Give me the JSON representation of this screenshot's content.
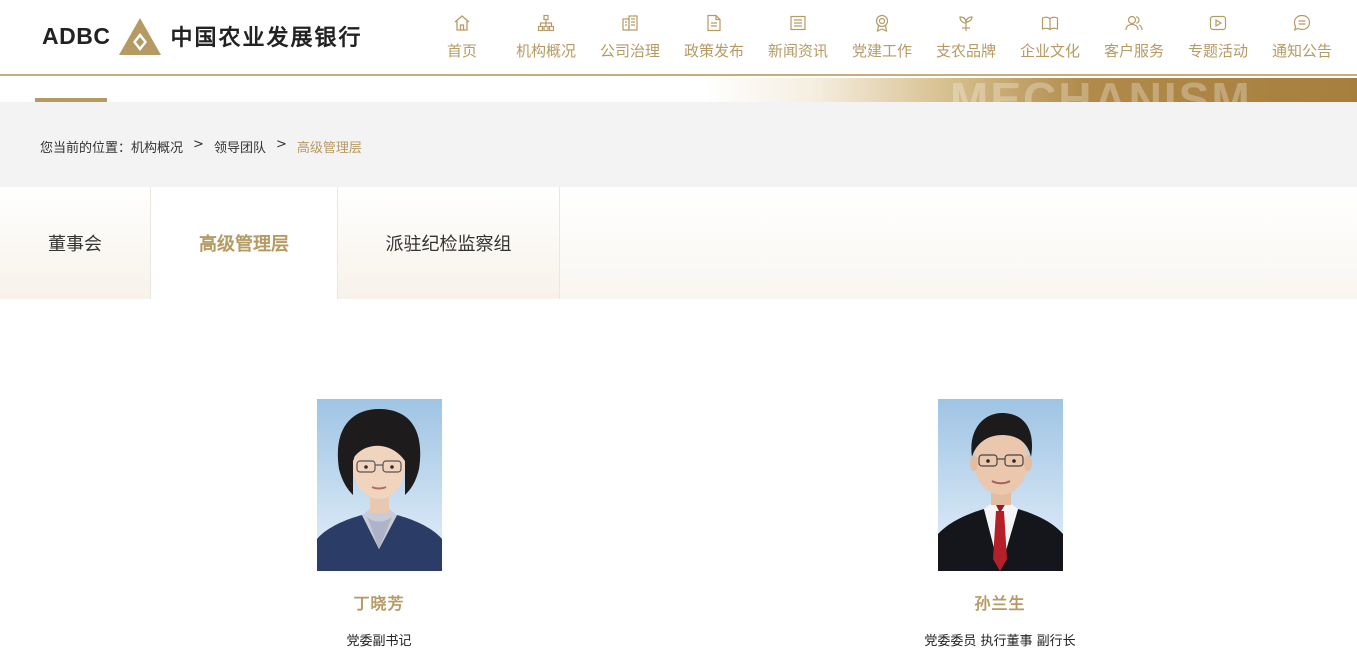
{
  "header": {
    "logo_en": "ADBC",
    "logo_cn": "中国农业发展银行",
    "brand_color": "#b69a64"
  },
  "nav": [
    {
      "label": "首页",
      "icon": "home-icon"
    },
    {
      "label": "机构概况",
      "icon": "org-chart-icon"
    },
    {
      "label": "公司治理",
      "icon": "building-icon"
    },
    {
      "label": "政策发布",
      "icon": "document-icon"
    },
    {
      "label": "新闻资讯",
      "icon": "newspaper-icon"
    },
    {
      "label": "党建工作",
      "icon": "badge-icon"
    },
    {
      "label": "支农品牌",
      "icon": "sprout-icon"
    },
    {
      "label": "企业文化",
      "icon": "book-icon"
    },
    {
      "label": "客户服务",
      "icon": "users-icon"
    },
    {
      "label": "专题活动",
      "icon": "play-icon"
    },
    {
      "label": "通知公告",
      "icon": "message-icon"
    }
  ],
  "banner": {
    "text": "MECHANISM"
  },
  "breadcrumb": {
    "prefix": "您当前的位置：",
    "items": [
      "机构概况",
      "领导团队"
    ],
    "current": "高级管理层",
    "separator": ">"
  },
  "tabs": [
    {
      "label": "董事会",
      "active": false
    },
    {
      "label": "高级管理层",
      "active": true
    },
    {
      "label": "派驻纪检监察组",
      "active": false
    }
  ],
  "people": [
    {
      "name": "丁晓芳",
      "title": "党委副书记"
    },
    {
      "name": "孙兰生",
      "title": "党委委员 执行董事 副行长"
    }
  ]
}
